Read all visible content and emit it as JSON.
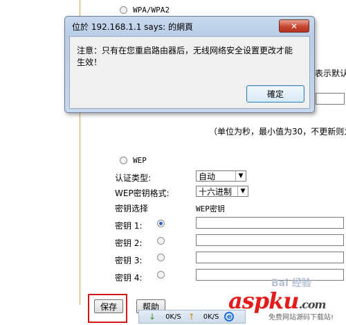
{
  "page": {
    "wpa_option": "WPA/WPA2",
    "partial_right_text": "表示默认",
    "interval_hint": "（单位为秒，最小值为30，不更新则为",
    "wep_option": "WEP",
    "auth_type_label": "认证类型:",
    "auth_type_value": "自动",
    "key_format_label": "WEP密钥格式:",
    "key_format_value": "十六进制",
    "key_select_label": "密钥选择",
    "wep_key_header": "WEP密钥",
    "keys": [
      {
        "label": "密钥 1:",
        "checked": true
      },
      {
        "label": "密钥 2:",
        "checked": false
      },
      {
        "label": "密钥 3:",
        "checked": false
      },
      {
        "label": "密钥 4:",
        "checked": false
      }
    ],
    "save_button": "保存",
    "help_button": "帮助"
  },
  "dialog": {
    "title": "位於 192.168.1.1 says: 的網頁",
    "message": "注意：只有在您重启路由器后，无线网络安全设置更改才能生效！",
    "ok_button": "確定",
    "close_glyph": "✕"
  },
  "statusbar": {
    "down_speed": "0K/S",
    "up_speed": "0K/S"
  },
  "watermark": {
    "logo": "aspku",
    "logo_suffix": ".com",
    "subtitle": "免费网站源码下载站!",
    "baidu": "Bai 经验"
  },
  "colors": {
    "highlight": "#d01818",
    "dialog_close": "#c6452d"
  }
}
